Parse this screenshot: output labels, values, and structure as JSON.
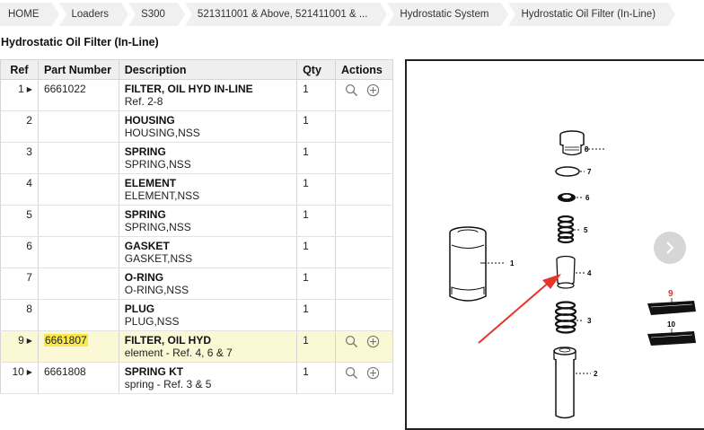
{
  "breadcrumb": [
    "HOME",
    "Loaders",
    "S300",
    "521311001 & Above, 521411001 & ...",
    "Hydrostatic System",
    "Hydrostatic Oil Filter (In-Line)"
  ],
  "page_title": "Hydrostatic Oil Filter (In-Line)",
  "table": {
    "headers": {
      "ref": "Ref",
      "part_number": "Part Number",
      "description": "Description",
      "qty": "Qty",
      "actions": "Actions"
    },
    "rows": [
      {
        "ref": "1",
        "has_arrow": true,
        "part_number": "6661022",
        "name": "FILTER, OIL HYD IN-LINE",
        "sub": "Ref. 2-8",
        "qty": "1",
        "actions": true,
        "highlight": false
      },
      {
        "ref": "2",
        "has_arrow": false,
        "part_number": "",
        "name": "HOUSING",
        "sub": "HOUSING,NSS",
        "qty": "1",
        "actions": false,
        "highlight": false
      },
      {
        "ref": "3",
        "has_arrow": false,
        "part_number": "",
        "name": "SPRING",
        "sub": "SPRING,NSS",
        "qty": "1",
        "actions": false,
        "highlight": false
      },
      {
        "ref": "4",
        "has_arrow": false,
        "part_number": "",
        "name": "ELEMENT",
        "sub": "ELEMENT,NSS",
        "qty": "1",
        "actions": false,
        "highlight": false
      },
      {
        "ref": "5",
        "has_arrow": false,
        "part_number": "",
        "name": "SPRING",
        "sub": "SPRING,NSS",
        "qty": "1",
        "actions": false,
        "highlight": false
      },
      {
        "ref": "6",
        "has_arrow": false,
        "part_number": "",
        "name": "GASKET",
        "sub": "GASKET,NSS",
        "qty": "1",
        "actions": false,
        "highlight": false
      },
      {
        "ref": "7",
        "has_arrow": false,
        "part_number": "",
        "name": "O-RING",
        "sub": "O-RING,NSS",
        "qty": "1",
        "actions": false,
        "highlight": false
      },
      {
        "ref": "8",
        "has_arrow": false,
        "part_number": "",
        "name": "PLUG",
        "sub": "PLUG,NSS",
        "qty": "1",
        "actions": false,
        "highlight": false
      },
      {
        "ref": "9",
        "has_arrow": true,
        "part_number": "6661807",
        "name": "FILTER, OIL HYD",
        "sub": "element - Ref. 4, 6 & 7",
        "qty": "1",
        "actions": true,
        "highlight": true
      },
      {
        "ref": "10",
        "has_arrow": true,
        "part_number": "6661808",
        "name": "SPRING KT",
        "sub": "spring - Ref. 3 & 5",
        "qty": "1",
        "actions": true,
        "highlight": false
      }
    ]
  },
  "diagram": {
    "callouts": [
      "1",
      "2",
      "3",
      "4",
      "5",
      "6",
      "7",
      "8",
      "9",
      "10"
    ],
    "colors": {
      "arrow": "#e8342a",
      "highlight_label": "#e8342a",
      "row_highlight": "#fbf8d6",
      "pn_highlight": "#f8e84a"
    },
    "icons": [
      "search-icon",
      "add-circle-icon",
      "chevron-right-icon"
    ]
  }
}
